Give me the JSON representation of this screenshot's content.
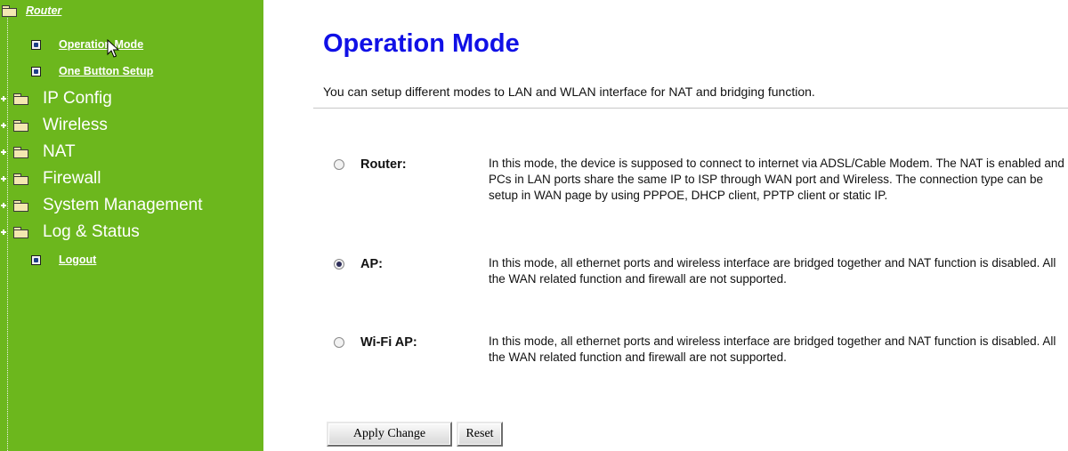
{
  "sidebar": {
    "root_label": "Router",
    "items": [
      {
        "label": "Operation Mode",
        "kind": "leaf"
      },
      {
        "label": "One Button Setup",
        "kind": "leaf"
      },
      {
        "label": "IP Config",
        "kind": "folder"
      },
      {
        "label": "Wireless",
        "kind": "folder"
      },
      {
        "label": "NAT",
        "kind": "folder"
      },
      {
        "label": "Firewall",
        "kind": "folder"
      },
      {
        "label": "System Management",
        "kind": "folder"
      },
      {
        "label": "Log & Status",
        "kind": "folder"
      },
      {
        "label": "Logout",
        "kind": "leaf"
      }
    ],
    "background_color": "#6cb71d"
  },
  "main": {
    "title": "Operation Mode",
    "title_color": "#1010e6",
    "intro": "You can setup different modes to LAN and WLAN interface for NAT and bridging function.",
    "modes": [
      {
        "label": "Router:",
        "selected": false,
        "description": "In this mode, the device is supposed to connect to internet via ADSL/Cable Modem. The NAT is enabled and PCs in LAN ports share the same IP to ISP through WAN port and Wireless. The connection type can be setup in WAN page by using PPPOE, DHCP client, PPTP client or static IP."
      },
      {
        "label": "AP:",
        "selected": true,
        "description": "In this mode, all ethernet ports and wireless interface are bridged together and NAT function is disabled. All the WAN related function and firewall are not supported."
      },
      {
        "label": "Wi-Fi AP:",
        "selected": false,
        "description": "In this mode, all ethernet ports and wireless interface are bridged together and NAT function is disabled. All the WAN related function and firewall are not supported."
      }
    ],
    "buttons": {
      "apply": "Apply Change",
      "reset": "Reset"
    }
  }
}
